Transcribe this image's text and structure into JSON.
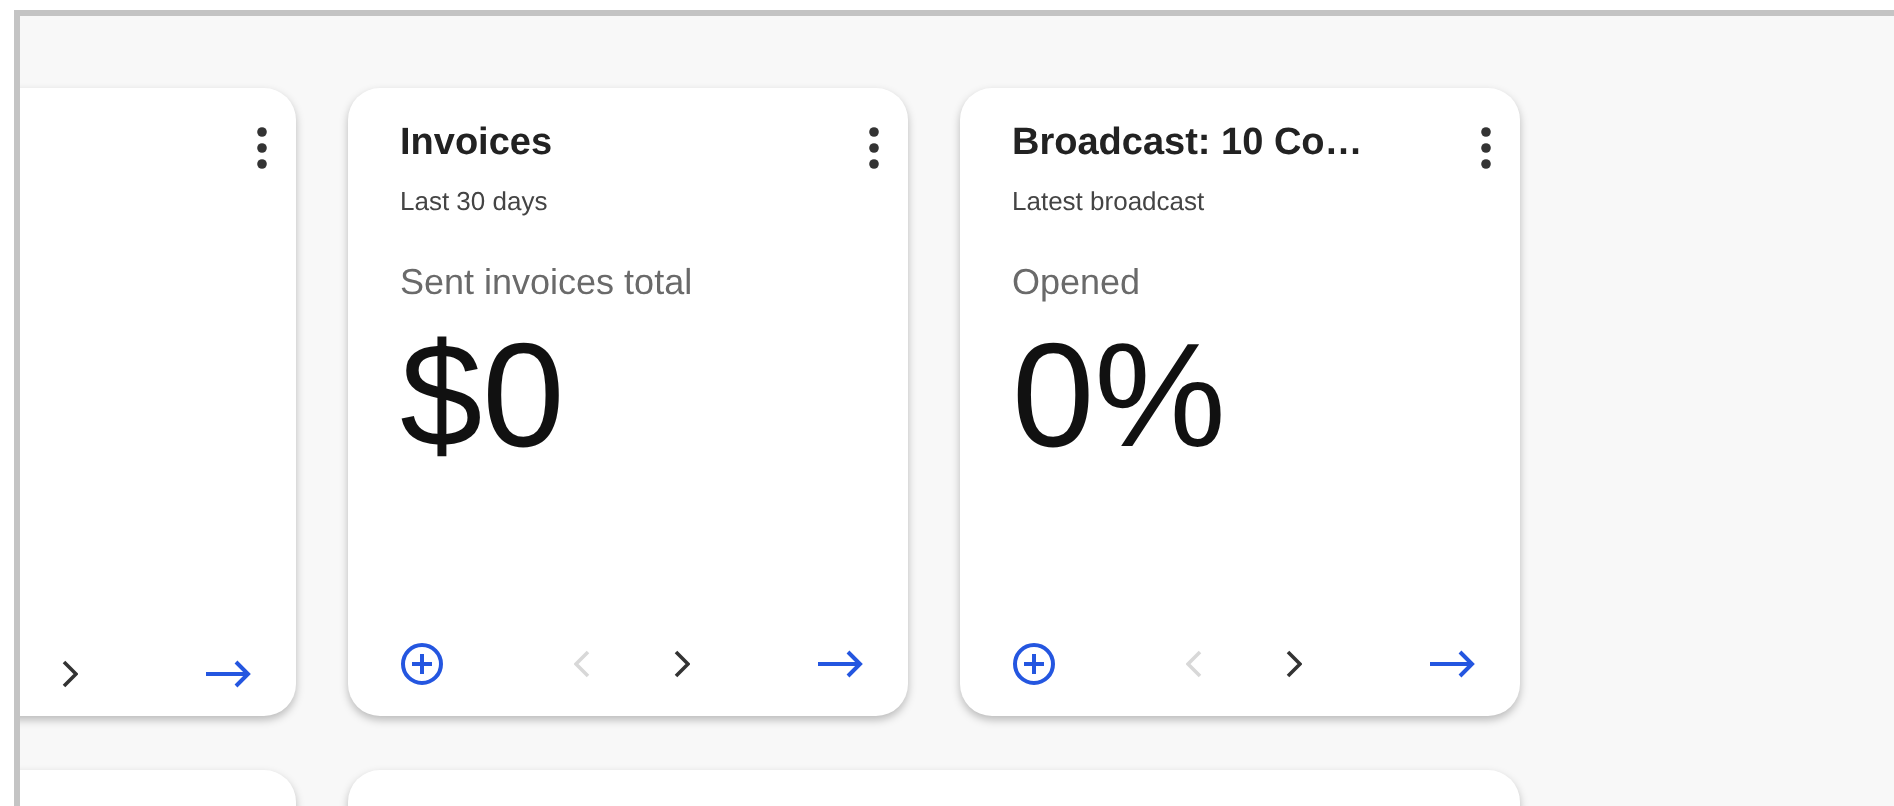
{
  "cards": [
    {
      "controls": [
        {
          "kind": "next",
          "disabled": false
        },
        {
          "kind": "open",
          "disabled": false
        }
      ]
    },
    {
      "title": "Invoices",
      "subtitle": "Last 30 days",
      "metric_label": "Sent invoices total",
      "value": "$0",
      "controls": [
        {
          "kind": "add",
          "disabled": false
        },
        {
          "kind": "prev",
          "disabled": true
        },
        {
          "kind": "next",
          "disabled": false
        },
        {
          "kind": "open",
          "disabled": false
        }
      ]
    },
    {
      "title": "Broadcast: 10 Co…",
      "subtitle": "Latest broadcast",
      "metric_label": "Opened",
      "value": "0%",
      "controls": [
        {
          "kind": "add",
          "disabled": false
        },
        {
          "kind": "prev",
          "disabled": true
        },
        {
          "kind": "next",
          "disabled": false
        },
        {
          "kind": "open",
          "disabled": false
        }
      ]
    }
  ],
  "lower_cards": [
    {
      "kind": "narrow"
    },
    {
      "kind": "wide"
    }
  ]
}
